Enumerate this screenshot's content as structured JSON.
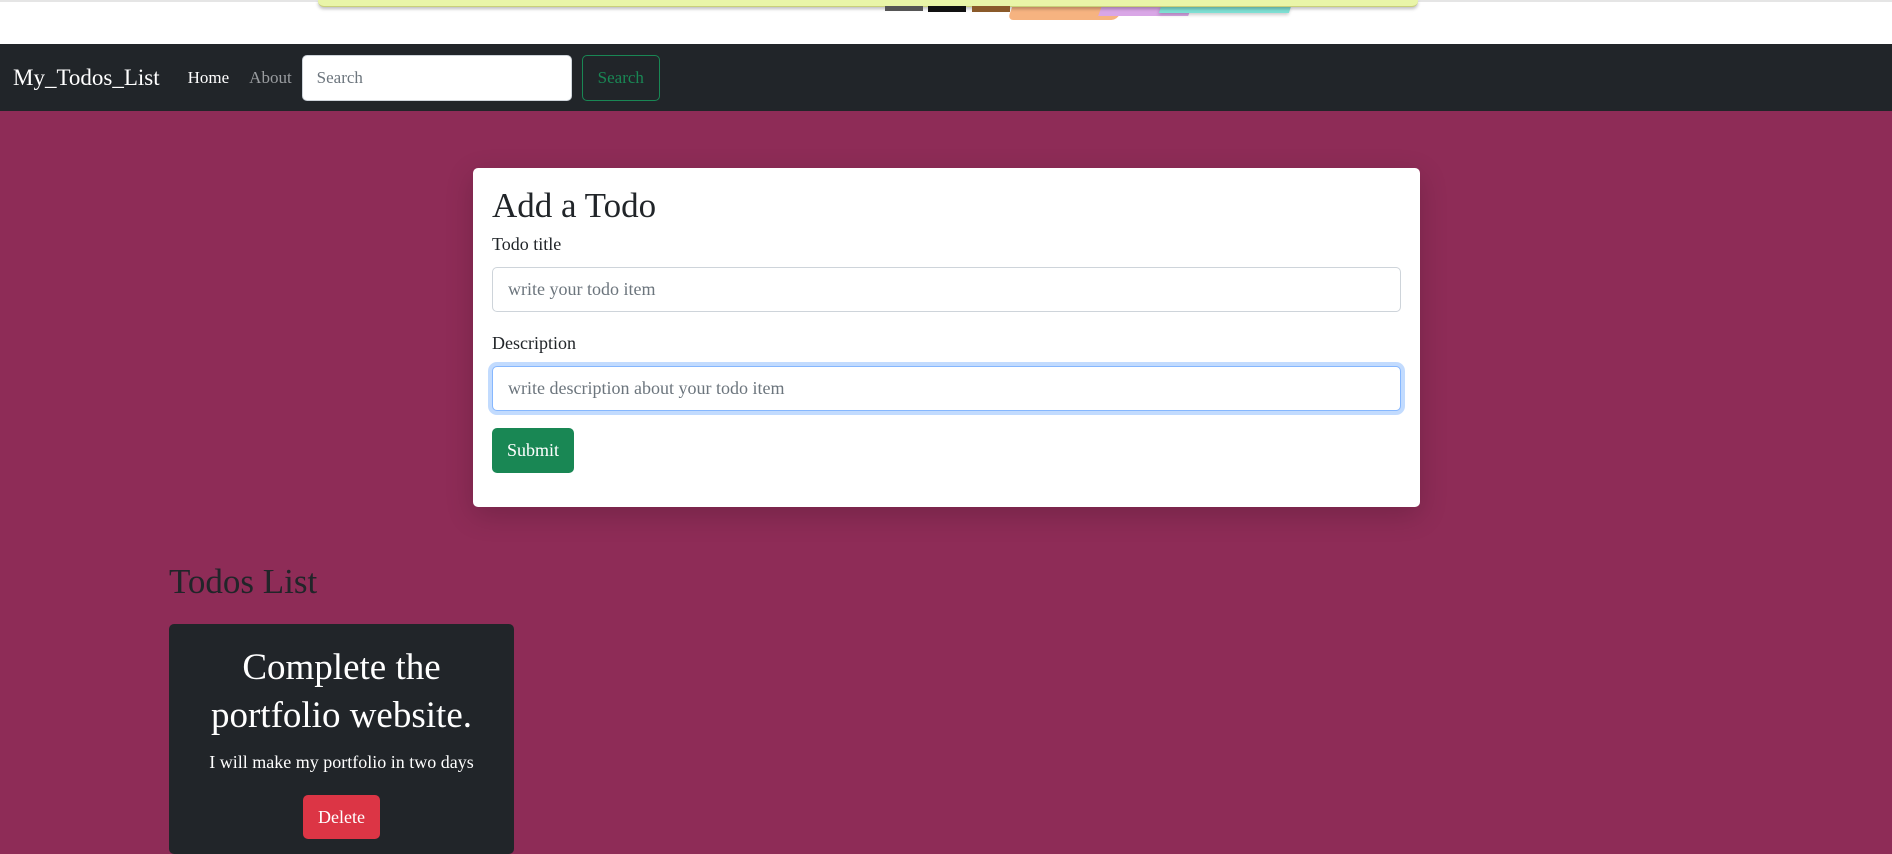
{
  "navbar": {
    "brand": "My_Todos_List",
    "links": [
      {
        "label": "Home",
        "active": true
      },
      {
        "label": "About",
        "active": false
      }
    ],
    "search": {
      "placeholder": "Search",
      "button_label": "Search"
    }
  },
  "add_todo": {
    "heading": "Add a Todo",
    "title_label": "Todo title",
    "title_placeholder": "write your todo item",
    "description_label": "Description",
    "description_placeholder": "write description about your todo item",
    "submit_label": "Submit"
  },
  "todos_list": {
    "heading": "Todos List",
    "items": [
      {
        "title": "Complete the portfolio website.",
        "description": "I will make my portfolio in two days",
        "delete_label": "Delete"
      }
    ]
  },
  "colors": {
    "page_bg": "#8e2c57",
    "navbar_bg": "#212529",
    "success": "#198754",
    "danger": "#dc3545"
  }
}
